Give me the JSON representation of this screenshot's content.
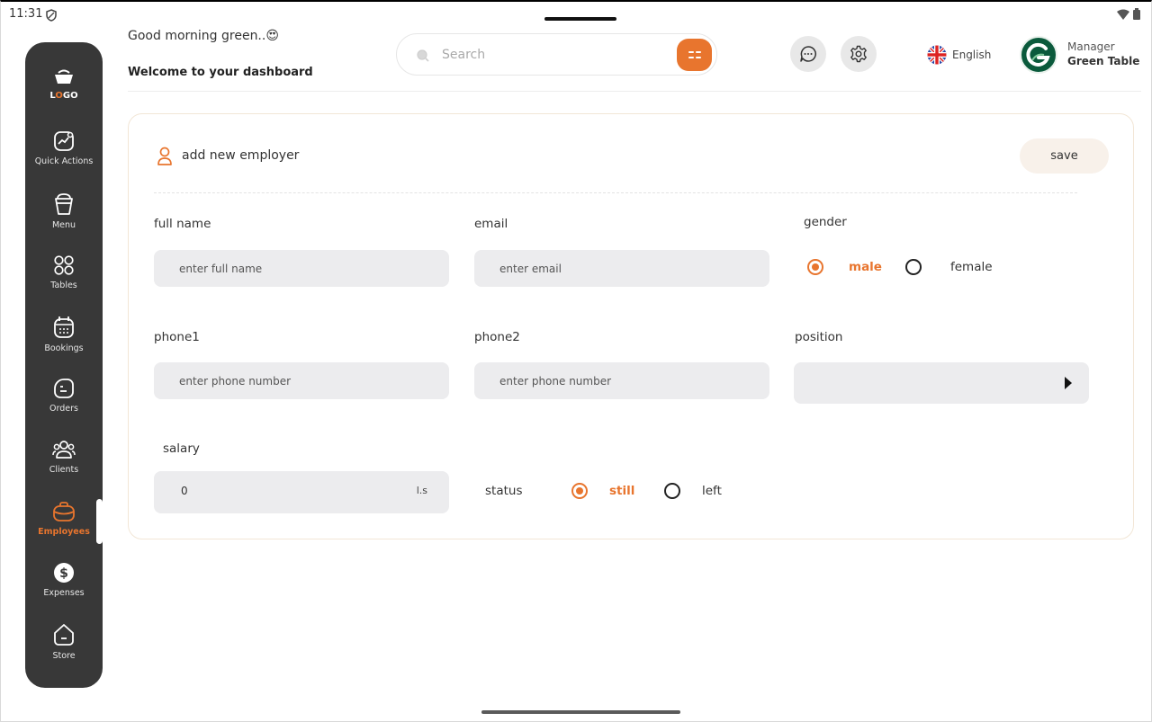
{
  "status_bar": {
    "time": "11:31"
  },
  "sidebar": {
    "logo": {
      "prefix": "L",
      "accent": "O",
      "suffix": "GO"
    },
    "items": [
      {
        "label": "Quick Actions",
        "icon": "chart-icon"
      },
      {
        "label": "Menu",
        "icon": "cup-icon"
      },
      {
        "label": "Tables",
        "icon": "grid-icon"
      },
      {
        "label": "Bookings",
        "icon": "calendar-icon"
      },
      {
        "label": "Orders",
        "icon": "orders-icon"
      },
      {
        "label": "Clients",
        "icon": "clients-icon"
      },
      {
        "label": "Employees",
        "icon": "briefcase-icon",
        "active": true
      },
      {
        "label": "Expenses",
        "icon": "dollar-icon"
      },
      {
        "label": "Store",
        "icon": "store-icon"
      }
    ]
  },
  "header": {
    "greeting": "Good morning green..😍",
    "welcome": "Welcome to your dashboard",
    "search_placeholder": "Search",
    "language": "English",
    "role": "Manager",
    "username": "Green Table"
  },
  "form": {
    "title": "add new employer",
    "save_label": "save",
    "full_name": {
      "label": "full name",
      "placeholder": "enter full name"
    },
    "email": {
      "label": "email",
      "placeholder": "enter email"
    },
    "gender": {
      "label": "gender",
      "options": [
        "male",
        "female"
      ],
      "selected": "male"
    },
    "phone1": {
      "label": "phone1",
      "placeholder": "enter phone number"
    },
    "phone2": {
      "label": "phone2",
      "placeholder": "enter phone number"
    },
    "position": {
      "label": "position"
    },
    "salary": {
      "label": "salary",
      "value": "0",
      "unit": "l.s"
    },
    "status": {
      "label": "status",
      "options": [
        "still",
        "left"
      ],
      "selected": "still"
    }
  },
  "colors": {
    "accent": "#e8752e",
    "sidebar": "#383838",
    "input_bg": "#ececee"
  }
}
